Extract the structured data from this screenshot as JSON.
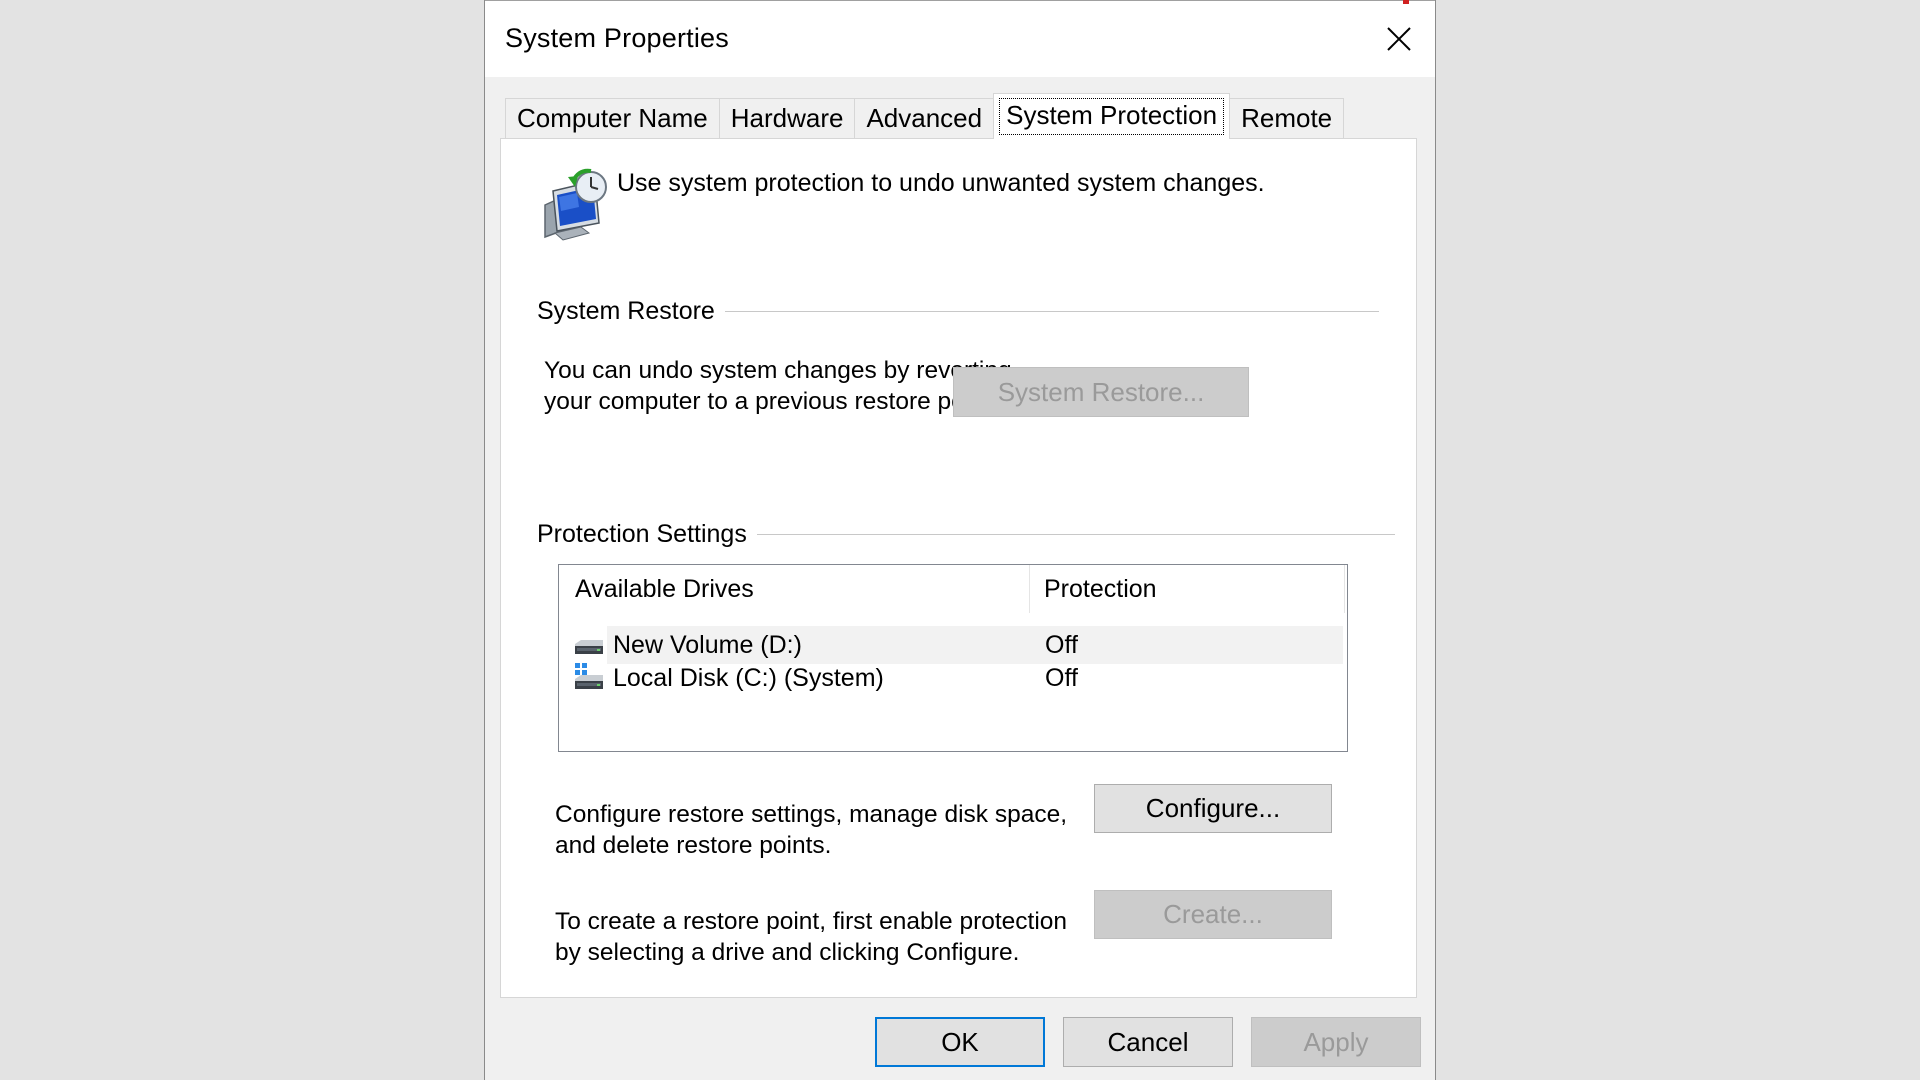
{
  "window": {
    "title": "System Properties",
    "close_icon": "close-icon"
  },
  "tabs": [
    {
      "label": "Computer Name",
      "active": false
    },
    {
      "label": "Hardware",
      "active": false
    },
    {
      "label": "Advanced",
      "active": false
    },
    {
      "label": "System Protection",
      "active": true
    },
    {
      "label": "Remote",
      "active": false
    }
  ],
  "intro": {
    "icon": "system-protection-icon",
    "text": "Use system protection to undo unwanted system changes."
  },
  "system_restore": {
    "group_label": "System Restore",
    "description_line1": "You can undo system changes by reverting",
    "description_line2": "your computer to a previous restore point.",
    "button_label": "System Restore...",
    "button_enabled": false
  },
  "protection_settings": {
    "group_label": "Protection Settings",
    "columns": [
      "Available Drives",
      "Protection"
    ],
    "drives": [
      {
        "name": "New Volume (D:)",
        "protection": "Off",
        "icon": "drive-icon",
        "selected": true
      },
      {
        "name": "Local Disk (C:) (System)",
        "protection": "Off",
        "icon": "system-drive-icon",
        "selected": false
      }
    ],
    "configure_text_line1": "Configure restore settings, manage disk space,",
    "configure_text_line2": "and delete restore points.",
    "configure_button": "Configure...",
    "create_text_line1": "To create a restore point, first enable protection",
    "create_text_line2": "by selecting a drive and clicking Configure.",
    "create_button": "Create...",
    "create_enabled": false
  },
  "footer": {
    "ok_label": "OK",
    "cancel_label": "Cancel",
    "apply_label": "Apply",
    "apply_enabled": false
  },
  "colors": {
    "accent": "#0078d7",
    "dialog_bg": "#f0f0f0",
    "panel_bg": "#ffffff",
    "disabled_text": "#9a9a9a"
  }
}
